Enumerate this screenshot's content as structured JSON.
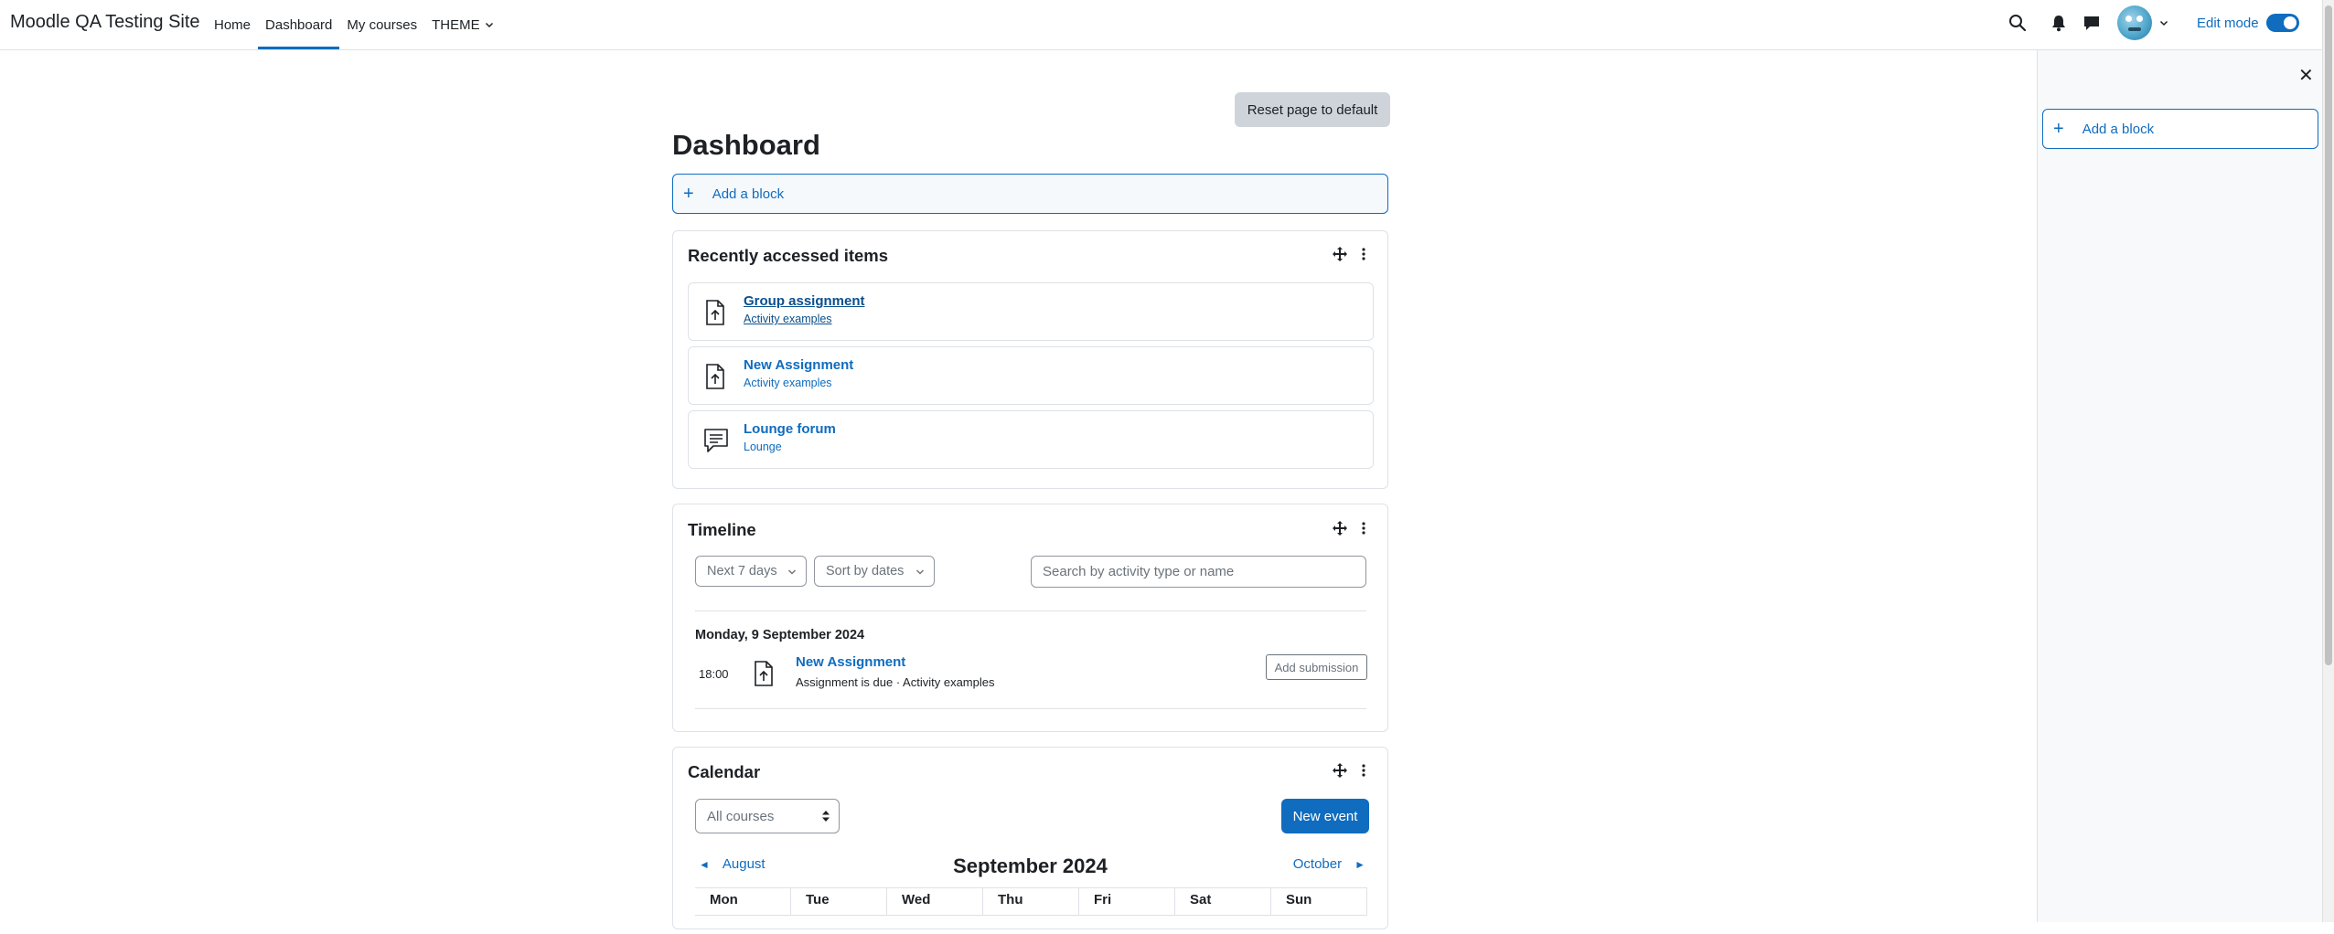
{
  "navbar": {
    "site_name": "Moodle QA Testing Site",
    "items": [
      {
        "label": "Home"
      },
      {
        "label": "Dashboard"
      },
      {
        "label": "My courses"
      },
      {
        "label": "THEME"
      }
    ],
    "edit_mode_label": "Edit mode",
    "edit_mode_on": true
  },
  "page": {
    "reset_label": "Reset page to default",
    "title": "Dashboard",
    "add_block_label": "Add a block"
  },
  "recent": {
    "title": "Recently accessed items",
    "items": [
      {
        "name": "Group assignment",
        "course": "Activity examples",
        "icon": "assignment-icon"
      },
      {
        "name": "New Assignment",
        "course": "Activity examples",
        "icon": "assignment-icon"
      },
      {
        "name": "Lounge forum",
        "course": "Lounge",
        "icon": "forum-icon"
      }
    ]
  },
  "timeline": {
    "title": "Timeline",
    "filter_label": "Next 7 days",
    "sort_label": "Sort by dates",
    "search_placeholder": "Search by activity type or name",
    "date_heading": "Monday, 9 September 2024",
    "event": {
      "time": "18:00",
      "name": "New Assignment",
      "description": "Assignment is due · Activity examples",
      "action_label": "Add submission"
    }
  },
  "calendar": {
    "title": "Calendar",
    "course_filter": "All courses",
    "new_event_label": "New event",
    "prev_month": "August",
    "current_month": "September 2024",
    "next_month": "October",
    "days": [
      "Mon",
      "Tue",
      "Wed",
      "Thu",
      "Fri",
      "Sat",
      "Sun"
    ]
  },
  "drawer": {
    "add_block_label": "Add a block"
  },
  "colors": {
    "accent": "#0f6cbf",
    "text": "#1d2125",
    "border": "#dee2e6",
    "drawer_bg": "#f8f9fa",
    "reset_button_bg": "#ced4da"
  }
}
